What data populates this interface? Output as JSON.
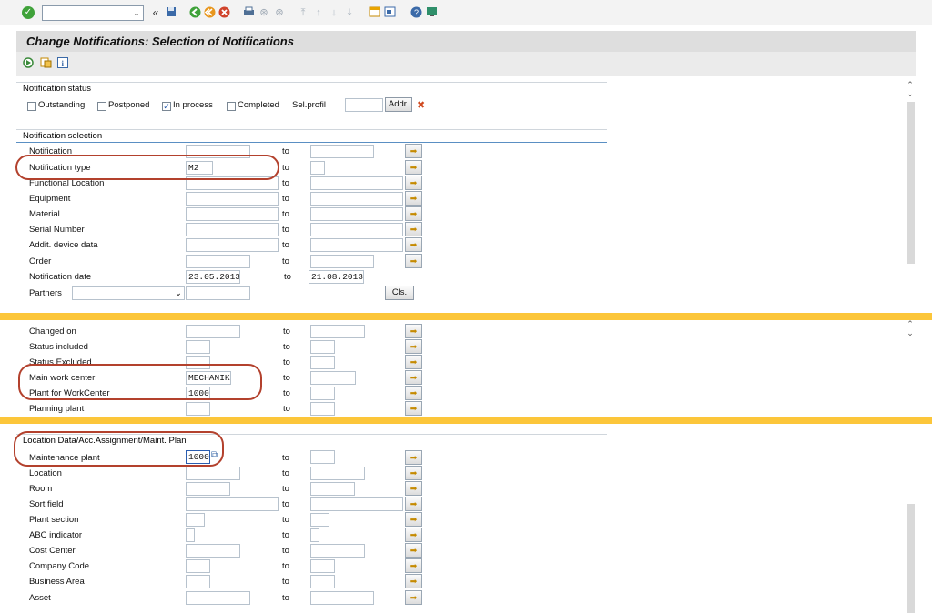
{
  "toolbar": {
    "back_glyph": "«",
    "command_field_value": "",
    "icons": [
      "enter-icon",
      "save-icon",
      "back-icon",
      "exit-icon",
      "cancel-icon",
      "print-icon",
      "find-icon",
      "find-next-icon",
      "first-page-icon",
      "previous-page-icon",
      "next-page-icon",
      "last-page-icon",
      "new-session-icon",
      "shortcut-icon",
      "help-icon",
      "layout-icon"
    ]
  },
  "title": "Change Notifications: Selection of Notifications",
  "app_toolbar": {
    "icons": [
      "execute-icon",
      "get-variant-icon",
      "program-info-icon"
    ]
  },
  "status_group": {
    "heading": "Notification status",
    "outstanding": {
      "label": "Outstanding",
      "checked": false
    },
    "postponed": {
      "label": "Postponed",
      "checked": false
    },
    "in_process": {
      "label": "In process",
      "checked": true
    },
    "completed": {
      "label": "Completed",
      "checked": false
    },
    "sel_profil_label": "Sel.profil",
    "sel_profil_value": "",
    "addr_button": "Addr.",
    "check_mark": "✓",
    "delete_glyph": "✖"
  },
  "selection_group": {
    "heading": "Notification selection",
    "to_label": "to",
    "rows": [
      {
        "label": "Notification",
        "from": "",
        "to": ""
      },
      {
        "label": "Notification type",
        "from": "M2",
        "to": ""
      },
      {
        "label": "Functional Location",
        "from": "",
        "to": ""
      },
      {
        "label": "Equipment",
        "from": "",
        "to": ""
      },
      {
        "label": "Material",
        "from": "",
        "to": ""
      },
      {
        "label": "Serial Number",
        "from": "",
        "to": ""
      },
      {
        "label": "Addit. device data",
        "from": "",
        "to": ""
      },
      {
        "label": "Order",
        "from": "",
        "to": ""
      },
      {
        "label": "Notification date",
        "from": "23.05.2013",
        "to": "21.08.2013"
      }
    ],
    "partners_label": "Partners",
    "partners_value": "",
    "cls_button": "Cls."
  },
  "mid_group": {
    "rows": [
      {
        "label": "Changed on",
        "from": "",
        "to": ""
      },
      {
        "label": "Status included",
        "from": "",
        "to": ""
      },
      {
        "label": "Status Excluded",
        "from": "",
        "to": ""
      },
      {
        "label": "Main work center",
        "from": "MECHANIK",
        "to": ""
      },
      {
        "label": "Plant for WorkCenter",
        "from": "1000",
        "to": ""
      },
      {
        "label": "Planning plant",
        "from": "",
        "to": ""
      }
    ]
  },
  "location_group": {
    "heading": "Location Data/Acc.Assignment/Maint. Plan",
    "rows": [
      {
        "label": "Maintenance plant",
        "from": "1000",
        "to": ""
      },
      {
        "label": "Location",
        "from": "",
        "to": ""
      },
      {
        "label": "Room",
        "from": "",
        "to": ""
      },
      {
        "label": "Sort field",
        "from": "",
        "to": ""
      },
      {
        "label": "Plant section",
        "from": "",
        "to": ""
      },
      {
        "label": "ABC indicator",
        "from": "",
        "to": ""
      },
      {
        "label": "Cost Center",
        "from": "",
        "to": ""
      },
      {
        "label": "Company Code",
        "from": "",
        "to": ""
      },
      {
        "label": "Business Area",
        "from": "",
        "to": ""
      },
      {
        "label": "Asset",
        "from": "",
        "to": ""
      }
    ]
  },
  "glyphs": {
    "dropdown": "⌄",
    "multi_select": "➡",
    "scroll_up": "⌃",
    "scroll_down": "⌄",
    "f4_help": "⧉"
  },
  "colors": {
    "highlight_oval": "#b3412d",
    "separator_band": "#fcc63a",
    "group_line": "#5a8fc3"
  }
}
